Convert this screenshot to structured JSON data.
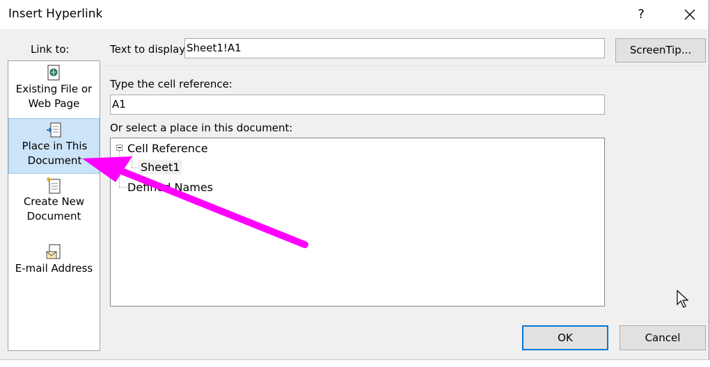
{
  "window": {
    "title": "Insert Hyperlink",
    "help_label": "?"
  },
  "sidebar": {
    "heading": "Link to:",
    "items": [
      {
        "label_line1": "Existing File or",
        "label_line2": "Web Page",
        "icon": "web-page-icon"
      },
      {
        "label_line1": "Place in This",
        "label_line2": "Document",
        "icon": "document-place-icon",
        "selected": true
      },
      {
        "label_line1": "Create New",
        "label_line2": "Document",
        "icon": "new-document-icon"
      },
      {
        "label_line1": "E-mail Address",
        "label_line2": "",
        "icon": "email-icon"
      }
    ]
  },
  "form": {
    "text_to_display_label": "Text to display:",
    "text_to_display_value": "Sheet1!A1",
    "screentip_label": "ScreenTip...",
    "cell_reference_label": "Type the cell reference:",
    "cell_reference_value": "A1",
    "place_label": "Or select a place in this document:"
  },
  "tree": {
    "root": "Cell Reference",
    "child": "Sheet1",
    "sibling": "Defined Names"
  },
  "buttons": {
    "ok": "OK",
    "cancel": "Cancel"
  },
  "colors": {
    "selection": "#cce4f7",
    "default_button_border": "#0078d7",
    "annotation_arrow": "#ff00ff"
  }
}
